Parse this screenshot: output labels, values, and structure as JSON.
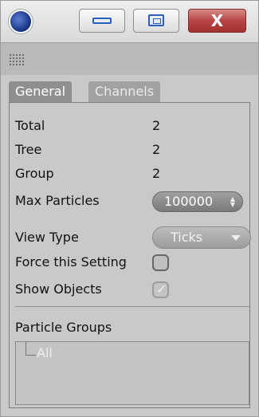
{
  "window": {
    "controls": {
      "app_icon": "app-sphere-icon",
      "minimize_icon": "minimize-icon",
      "maximize_icon": "maximize-icon",
      "close_icon": "close-icon",
      "close_glyph": "X"
    },
    "grip_icon": "grip-icon"
  },
  "tabs": [
    {
      "label": "General",
      "active": true
    },
    {
      "label": "Channels",
      "active": false
    }
  ],
  "stats": {
    "total_label": "Total",
    "total_value": "2",
    "tree_label": "Tree",
    "tree_value": "2",
    "group_label": "Group",
    "group_value": "2"
  },
  "max_particles": {
    "label": "Max Particles",
    "value": "100000"
  },
  "view_type": {
    "label": "View Type",
    "selected": "Ticks"
  },
  "force_setting": {
    "label": "Force this Setting",
    "checked": false
  },
  "show_objects": {
    "label": "Show Objects",
    "checked": true
  },
  "particle_groups": {
    "label": "Particle Groups",
    "items": [
      "All"
    ]
  },
  "colors": {
    "panel_bg": "#c9c9c9",
    "close_red": "#b84545",
    "control_blue": "#2a5fc2"
  }
}
